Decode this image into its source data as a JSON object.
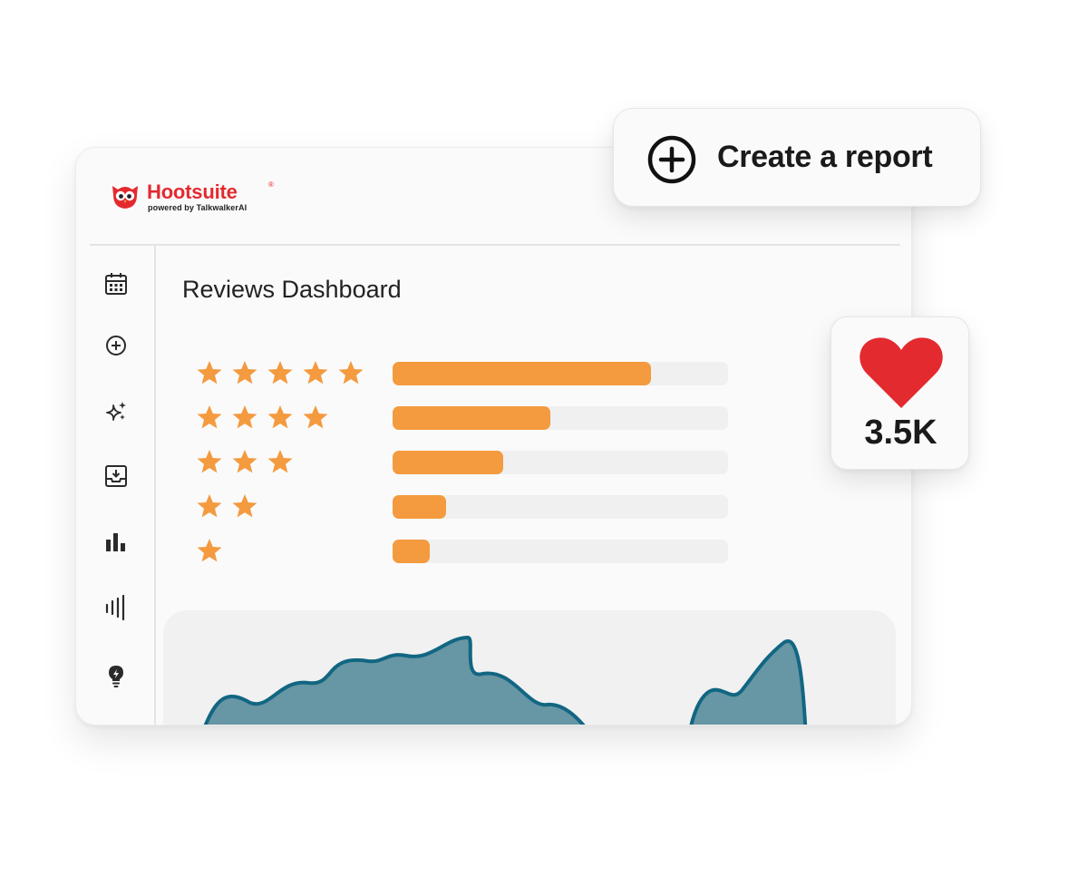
{
  "brand": {
    "name": "Hootsuite",
    "registered": "®",
    "tagline": "powered by TalkwalkerAI",
    "color": "#e32a2f"
  },
  "sidebar": {
    "items": [
      {
        "name": "calendar",
        "icon": "calendar-icon"
      },
      {
        "name": "create",
        "icon": "plus-circle-icon"
      },
      {
        "name": "ai",
        "icon": "sparkles-icon"
      },
      {
        "name": "inbox",
        "icon": "inbox-download-icon"
      },
      {
        "name": "analytics",
        "icon": "bar-chart-icon"
      },
      {
        "name": "listening",
        "icon": "waveform-icon"
      },
      {
        "name": "insights",
        "icon": "lightbulb-icon"
      }
    ]
  },
  "page": {
    "title": "Reviews Dashboard"
  },
  "ratings": [
    {
      "stars": 5,
      "fraction": 0.77
    },
    {
      "stars": 4,
      "fraction": 0.47
    },
    {
      "stars": 3,
      "fraction": 0.33
    },
    {
      "stars": 2,
      "fraction": 0.16
    },
    {
      "stars": 1,
      "fraction": 0.11
    }
  ],
  "colors": {
    "star": "#f49a3f",
    "bar_fill": "#f49a3f",
    "bar_track": "#f0f0f0",
    "area_fill": "#6796a4",
    "area_stroke": "#126682",
    "heart": "#e32a2f"
  },
  "report_card": {
    "label": "Create a report",
    "icon": "plus-circle-icon"
  },
  "likes_card": {
    "icon": "heart-icon",
    "count": "3.5K"
  }
}
